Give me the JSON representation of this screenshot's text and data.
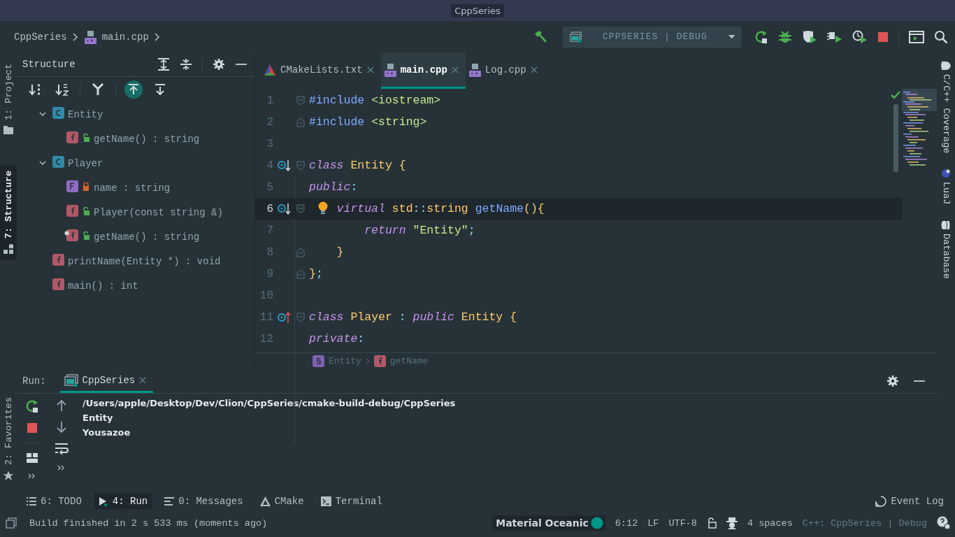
{
  "window": {
    "title": "CppSeries"
  },
  "navbar": {
    "breadcrumb": [
      "CppSeries",
      "main.cpp"
    ],
    "run_config": "CPPSERIES | DEBUG"
  },
  "left_strip": [
    {
      "label": "1: Project",
      "selected": false
    },
    {
      "label": "7: Structure",
      "selected": true
    }
  ],
  "favorites_tab": "2: Favorites",
  "structure": {
    "title": "Structure",
    "toolbar": [
      {
        "kind": "sort-visibility",
        "on": false
      },
      {
        "kind": "sort-alpha",
        "on": false
      },
      {
        "kind": "inherited",
        "on": false
      },
      {
        "kind": "autoscroll-from",
        "on": true
      },
      {
        "kind": "autoscroll-to",
        "on": false
      }
    ],
    "tree": [
      {
        "kind": "class",
        "label": "Entity",
        "expanded": true,
        "children": [
          {
            "kind": "function",
            "locked": false,
            "label": "getName() : string"
          }
        ]
      },
      {
        "kind": "class",
        "label": "Player",
        "expanded": true,
        "children": [
          {
            "kind": "field",
            "locked": true,
            "label": "name : string"
          },
          {
            "kind": "function",
            "locked": false,
            "label": "Player(const string &)"
          },
          {
            "kind": "function",
            "locked": false,
            "override": true,
            "label": "getName() : string"
          }
        ]
      },
      {
        "kind": "function",
        "label": "printName(Entity *) : void"
      },
      {
        "kind": "function",
        "label": "main() : int"
      }
    ]
  },
  "tabs": [
    {
      "label": "CMakeLists.txt",
      "kind": "cmake",
      "selected": false
    },
    {
      "label": "main.cpp",
      "kind": "cpp",
      "selected": true
    },
    {
      "label": "Log.cpp",
      "kind": "cpp",
      "selected": false
    }
  ],
  "editor": {
    "lines": [
      {
        "number": "1",
        "current": false,
        "bulb": false,
        "fold": {
          "kind": "start"
        },
        "tokens": [
          {
            "kind": "directive",
            "text": "#include "
          },
          {
            "kind": "string",
            "text": "<iostream>"
          }
        ]
      },
      {
        "number": "2",
        "current": false,
        "bulb": false,
        "fold": {
          "kind": "end"
        },
        "tokens": [
          {
            "kind": "directive",
            "text": "#include "
          },
          {
            "kind": "string",
            "text": "<string>"
          }
        ]
      },
      {
        "number": "3",
        "current": false,
        "bulb": false
      },
      {
        "number": "4",
        "current": false,
        "bulb": false,
        "marker": {
          "kind": "overridden"
        },
        "fold": {
          "kind": "start"
        },
        "tokens": [
          {
            "kind": "keyword",
            "text": "class "
          },
          {
            "kind": "type",
            "text": "Entity "
          },
          {
            "kind": "brace",
            "text": "{"
          }
        ]
      },
      {
        "number": "5",
        "current": false,
        "bulb": false,
        "tokens": [
          {
            "kind": "keyword",
            "text": "public"
          },
          {
            "kind": "operator",
            "text": ":"
          }
        ]
      },
      {
        "number": "6",
        "current": true,
        "bulb": true,
        "marker": {
          "kind": "overridden"
        },
        "fold": {
          "kind": "start"
        },
        "tokens": [
          {
            "kind": "keyword",
            "text": "    virtual "
          },
          {
            "kind": "type",
            "text": "std"
          },
          {
            "kind": "operator",
            "text": "::"
          },
          {
            "kind": "type",
            "text": "string "
          },
          {
            "kind": "function",
            "text": "getName"
          },
          {
            "kind": "brace",
            "text": "(){"
          }
        ]
      },
      {
        "number": "7",
        "current": false,
        "bulb": false,
        "tokens": [
          {
            "kind": "keyword",
            "text": "        return "
          },
          {
            "kind": "string",
            "text": "\"Entity\""
          },
          {
            "kind": "operator",
            "text": ";"
          }
        ]
      },
      {
        "number": "8",
        "current": false,
        "bulb": false,
        "fold": {
          "kind": "end"
        },
        "tokens": [
          {
            "kind": "brace",
            "text": "    }"
          }
        ]
      },
      {
        "number": "9",
        "current": false,
        "bulb": false,
        "fold": {
          "kind": "end"
        },
        "tokens": [
          {
            "kind": "brace",
            "text": "}"
          },
          {
            "kind": "operator",
            "text": ";"
          }
        ]
      },
      {
        "number": "10",
        "current": false,
        "bulb": false
      },
      {
        "number": "11",
        "current": false,
        "bulb": false,
        "marker": {
          "kind": "overrides"
        },
        "fold": {
          "kind": "start"
        },
        "tokens": [
          {
            "kind": "keyword",
            "text": "class "
          },
          {
            "kind": "type",
            "text": "Player "
          },
          {
            "kind": "operator",
            "text": ": "
          },
          {
            "kind": "keyword",
            "text": "public "
          },
          {
            "kind": "type",
            "text": "Entity "
          },
          {
            "kind": "brace",
            "text": "{"
          }
        ]
      },
      {
        "number": "12",
        "current": false,
        "bulb": false,
        "tokens": [
          {
            "kind": "keyword",
            "text": "private"
          },
          {
            "kind": "operator",
            "text": ":"
          }
        ]
      }
    ],
    "breadcrumb": [
      {
        "kind": "struct",
        "label": "Entity"
      },
      {
        "kind": "function",
        "label": "getName"
      }
    ]
  },
  "right_strip": [
    {
      "label": "C/C++ Coverage",
      "kind": "coverage"
    },
    {
      "label": "LuaJ",
      "kind": "lua"
    },
    {
      "label": "Database",
      "kind": "database"
    }
  ],
  "run": {
    "label": "Run:",
    "tab": "CppSeries",
    "output": [
      "/Users/apple/Desktop/Dev/Clion/CppSeries/cmake-build-debug/CppSeries",
      "Entity",
      "Yousazoe"
    ]
  },
  "tool_tabs": [
    {
      "label": "6: TODO",
      "kind": "todo",
      "selected": false
    },
    {
      "label": "4: Run",
      "kind": "run",
      "selected": true
    },
    {
      "label": "0: Messages",
      "kind": "messages",
      "selected": false
    },
    {
      "label": "CMake",
      "kind": "cmake",
      "selected": false
    },
    {
      "label": "Terminal",
      "kind": "terminal",
      "selected": false
    }
  ],
  "event_log": "Event Log",
  "status_bar": {
    "message": "Build finished in 2 s 533 ms (moments ago)",
    "theme": "Material Oceanic",
    "position": "6:12",
    "line_separator": "LF",
    "encoding": "UTF-8",
    "indent": "4 spaces",
    "context": "C++: CppSeries | Debug"
  }
}
